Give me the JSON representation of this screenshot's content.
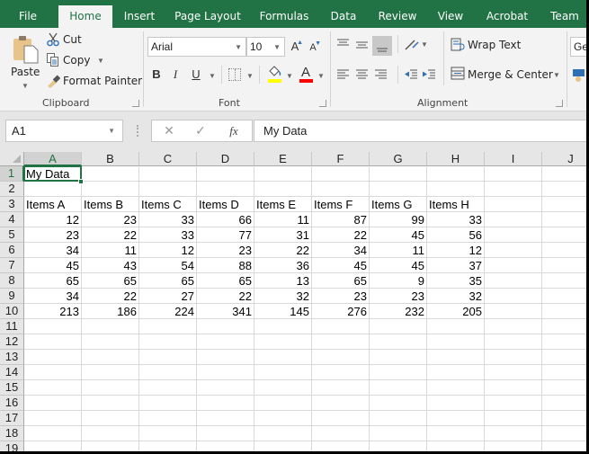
{
  "ribbon_tabs": [
    {
      "label": "File",
      "active": false
    },
    {
      "label": "Home",
      "active": true
    },
    {
      "label": "Insert",
      "active": false
    },
    {
      "label": "Page Layout",
      "active": false
    },
    {
      "label": "Formulas",
      "active": false
    },
    {
      "label": "Data",
      "active": false
    },
    {
      "label": "Review",
      "active": false
    },
    {
      "label": "View",
      "active": false
    },
    {
      "label": "Acrobat",
      "active": false
    },
    {
      "label": "Team",
      "active": false
    }
  ],
  "clipboard": {
    "paste_label": "Paste",
    "cut_label": "Cut",
    "copy_label": "Copy",
    "format_painter_label": "Format Painter",
    "group_label": "Clipboard"
  },
  "font": {
    "font_name": "Arial",
    "font_size": "10",
    "bold_label": "B",
    "italic_label": "I",
    "underline_label": "U",
    "font_color_label": "A",
    "grow_label": "A",
    "shrink_label": "A",
    "group_label": "Font",
    "highlight_color": "#ffff00",
    "font_color": "#ff0000"
  },
  "alignment": {
    "wrap_text_label": "Wrap Text",
    "merge_center_label": "Merge & Center",
    "group_label": "Alignment"
  },
  "number": {
    "format_partial": "Ge"
  },
  "formula_bar": {
    "name_box": "A1",
    "cancel_glyph": "✕",
    "enter_glyph": "✓",
    "fx_label": "fx",
    "formula": "My Data"
  },
  "sheet": {
    "columns": [
      "A",
      "B",
      "C",
      "D",
      "E",
      "F",
      "G",
      "H",
      "I",
      "J"
    ],
    "rows": [
      "1",
      "2",
      "3",
      "4",
      "5",
      "6",
      "7",
      "8",
      "9",
      "10",
      "11",
      "12",
      "13",
      "14",
      "15",
      "16",
      "17",
      "18",
      "19"
    ],
    "selected_cell": "A1",
    "title": "My Data",
    "headers": [
      "Items A",
      "Items B",
      "Items C",
      "Items D",
      "Items E",
      "Items F",
      "Items G",
      "Items H"
    ],
    "data_rows": [
      [
        12,
        23,
        33,
        66,
        11,
        87,
        99,
        33
      ],
      [
        23,
        22,
        33,
        77,
        31,
        22,
        45,
        56
      ],
      [
        34,
        11,
        12,
        23,
        22,
        34,
        11,
        12
      ],
      [
        45,
        43,
        54,
        88,
        36,
        45,
        45,
        37
      ],
      [
        65,
        65,
        65,
        65,
        13,
        65,
        9,
        35
      ],
      [
        34,
        22,
        27,
        22,
        32,
        23,
        23,
        32
      ],
      [
        213,
        186,
        224,
        341,
        145,
        276,
        232,
        205
      ]
    ]
  },
  "colors": {
    "brand_green": "#217346"
  }
}
